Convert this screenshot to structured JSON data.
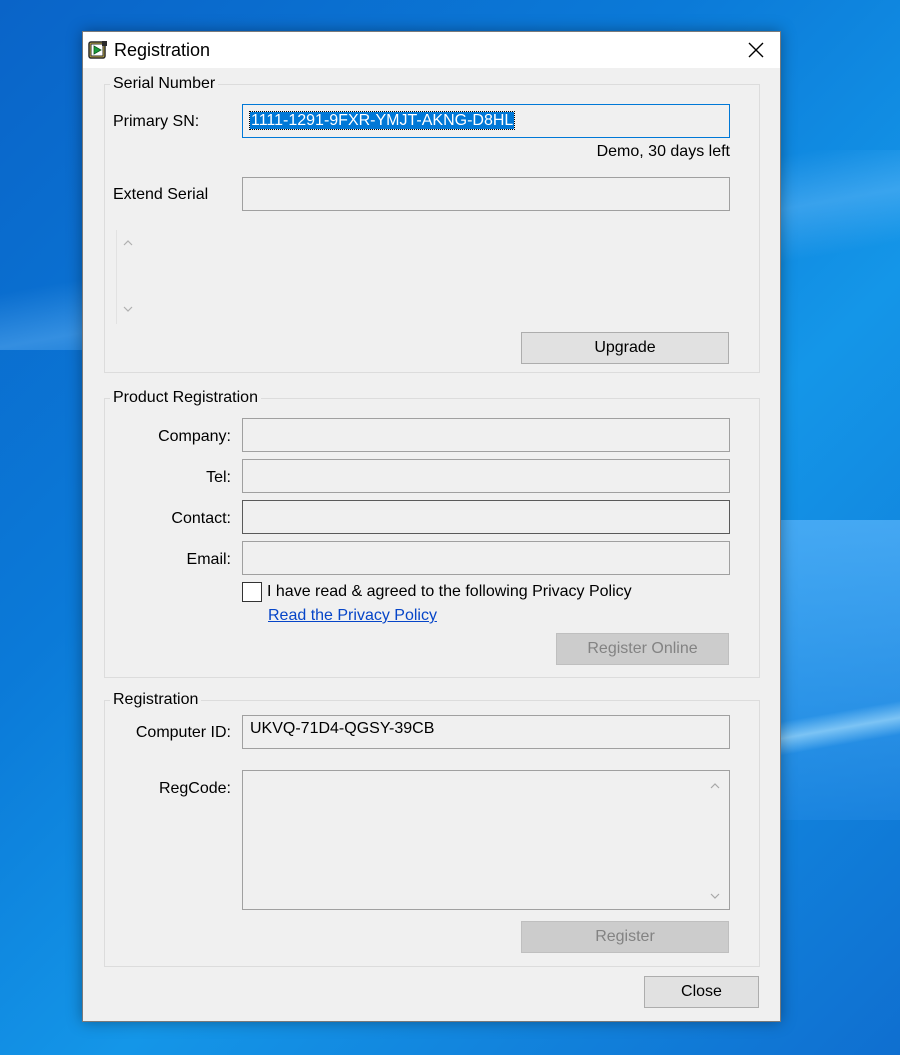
{
  "window": {
    "title": "Registration",
    "close_glyph": "✕",
    "icon": "app-icon"
  },
  "serial": {
    "legend": "Serial Number",
    "primary_label": "Primary SN:",
    "primary_value": "1111-1291-9FXR-YMJT-AKNG-D8HL",
    "status": "Demo, 30 days left",
    "extend_label": "Extend Serial",
    "extend_value": "",
    "upgrade_button": "Upgrade"
  },
  "product": {
    "legend": "Product Registration",
    "company_label": "Company:",
    "tel_label": "Tel:",
    "contact_label": "Contact:",
    "email_label": "Email:",
    "company_value": "",
    "tel_value": "",
    "contact_value": "",
    "email_value": "",
    "agree_label": "I have read & agreed to the following Privacy Policy",
    "privacy_link": "Read the Privacy Policy",
    "register_online_button": "Register Online"
  },
  "registration": {
    "legend": "Registration",
    "computer_id_label": "Computer ID:",
    "computer_id_value": "UKVQ-71D4-QGSY-39CB",
    "regcode_label": "RegCode:",
    "regcode_value": "",
    "register_button": "Register"
  },
  "footer": {
    "close_button": "Close"
  },
  "colors": {
    "selection": "#0078d7",
    "link": "#0645c8",
    "dialog_bg": "#f0f0f0"
  }
}
